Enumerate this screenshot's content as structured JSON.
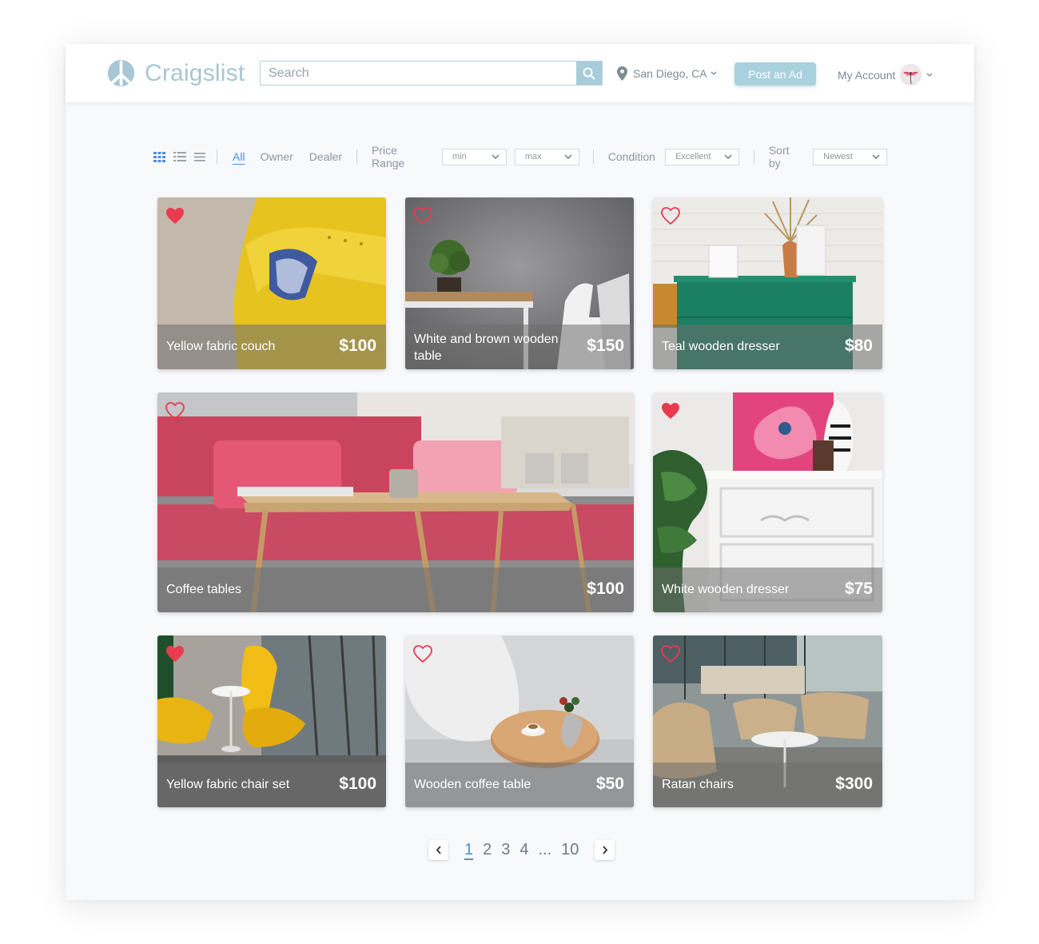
{
  "app": {
    "logo_text": "Craigslist",
    "brand_color": "#a8c6d3",
    "accent_color": "#a9d1de"
  },
  "header": {
    "search_placeholder": "Search",
    "location": "San Diego, CA",
    "post_button": "Post an Ad",
    "account_label": "My Account"
  },
  "filters": {
    "view_modes": [
      "grid-icon",
      "list-icon",
      "compact-list-icon"
    ],
    "active_view": "grid",
    "tabs": [
      "All",
      "Owner",
      "Dealer"
    ],
    "active_tab": "All",
    "price_range_label": "Price Range",
    "price_min": "min",
    "price_max": "max",
    "condition_label": "Condition",
    "condition_value": "Excellent",
    "sort_label": "Sort by",
    "sort_value": "Newest"
  },
  "listings": [
    {
      "title": "Yellow fabric couch",
      "price": "$100",
      "favorited": true
    },
    {
      "title": "White and brown wooden table",
      "price": "$150",
      "favorited": false
    },
    {
      "title": "Teal wooden dresser",
      "price": "$80",
      "favorited": false
    },
    {
      "title": "Coffee tables",
      "price": "$100",
      "favorited": false
    },
    {
      "title": "White wooden dresser",
      "price": "$75",
      "favorited": true
    },
    {
      "title": "Yellow fabric chair set",
      "price": "$100",
      "favorited": true
    },
    {
      "title": "Wooden coffee table",
      "price": "$50",
      "favorited": false
    },
    {
      "title": "Ratan chairs",
      "price": "$300",
      "favorited": false
    }
  ],
  "pagination": {
    "pages": [
      "1",
      "2",
      "3",
      "4",
      "...",
      "10"
    ],
    "current": "1"
  }
}
